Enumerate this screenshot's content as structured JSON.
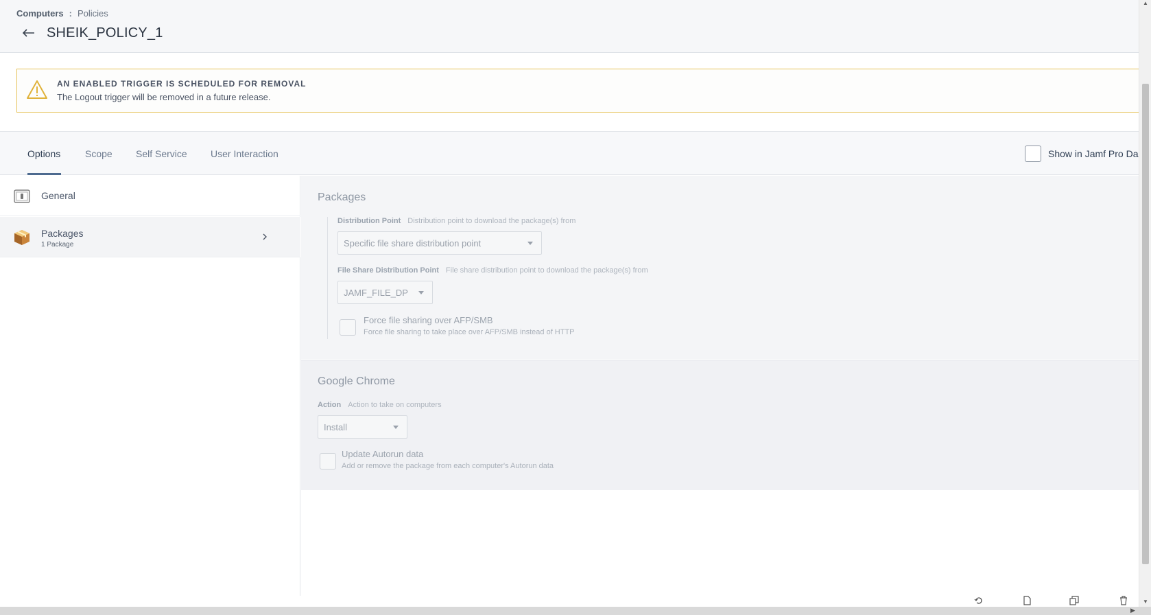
{
  "breadcrumb": {
    "section": "Computers",
    "separator": ":",
    "page": "Policies"
  },
  "header": {
    "title": "SHEIK_POLICY_1"
  },
  "banner": {
    "title": "AN ENABLED TRIGGER IS SCHEDULED FOR REMOVAL",
    "message": "The Logout trigger will be removed in a future release."
  },
  "tabs": [
    {
      "label": "Options",
      "active": true
    },
    {
      "label": "Scope",
      "active": false
    },
    {
      "label": "Self Service",
      "active": false
    },
    {
      "label": "User Interaction",
      "active": false
    }
  ],
  "show_in_dashboard": {
    "label": "Show in Jamf Pro Das",
    "checked": false
  },
  "sidebar": {
    "items": [
      {
        "label": "General",
        "icon": "general-icon"
      },
      {
        "label": "Packages",
        "sublabel": "1 Package",
        "icon": "package-icon",
        "selected": true
      }
    ]
  },
  "packages": {
    "title": "Packages",
    "distribution_point": {
      "label": "Distribution Point",
      "hint": "Distribution point to download the package(s) from",
      "value": "Specific file share distribution point"
    },
    "file_share_dp": {
      "label": "File Share Distribution Point",
      "hint": "File share distribution point to download the package(s) from",
      "value": "JAMF_FILE_DP"
    },
    "force_smb": {
      "label": "Force file sharing over AFP/SMB",
      "sub": "Force file sharing to take place over AFP/SMB instead of HTTP",
      "checked": false
    }
  },
  "chrome": {
    "title": "Google Chrome",
    "action": {
      "label": "Action",
      "hint": "Action to take on computers",
      "value": "Install"
    },
    "autorun": {
      "label": "Update Autorun data",
      "sub": "Add or remove the package from each computer's Autorun data",
      "checked": false
    }
  },
  "colors": {
    "warning_border": "#e6c25a",
    "warning_icon": "#e0b23a",
    "tab_active_underline": "#4d6a8f"
  }
}
